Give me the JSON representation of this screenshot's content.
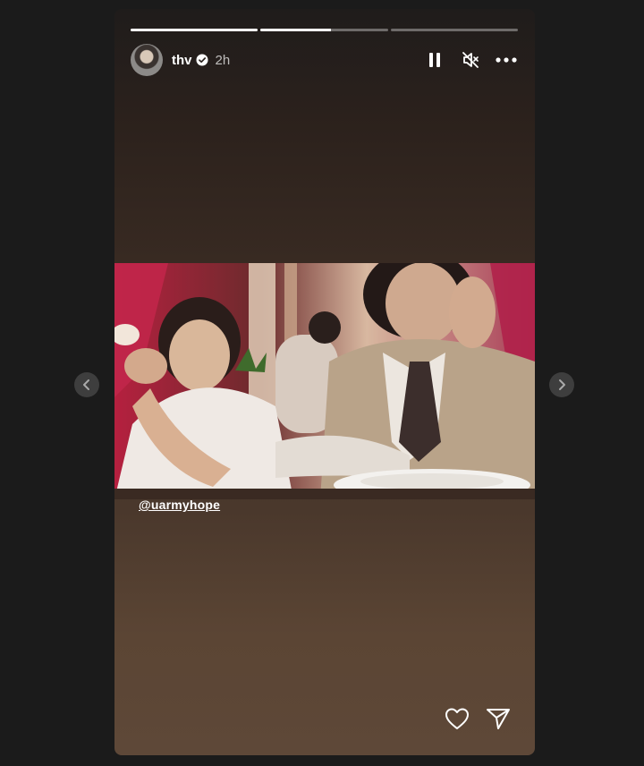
{
  "story": {
    "username": "thv",
    "timestamp": "2h",
    "mention": "@uarmyhope",
    "progress": [
      1,
      0.55,
      0
    ],
    "icons": {
      "verified": "verified-badge-icon",
      "pause": "pause-icon",
      "mute": "muted-speaker-icon",
      "more": "more-options-icon",
      "like": "heart-icon",
      "share": "send-icon",
      "prev": "chevron-left-icon",
      "next": "chevron-right-icon"
    },
    "colors": {
      "background": "#1b1b1b",
      "accent": "#ffffff"
    }
  }
}
